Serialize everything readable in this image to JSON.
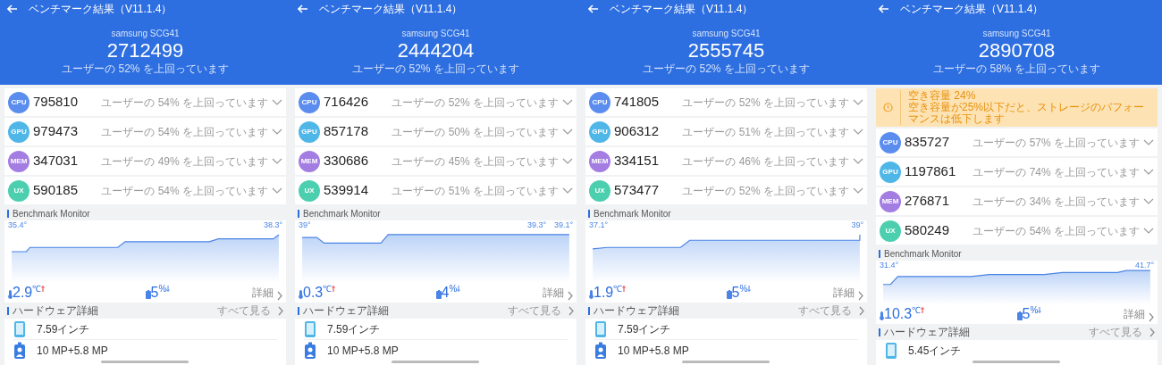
{
  "panels": [
    {
      "title": "ベンチマーク結果（V11.1.4）",
      "device": "samsung SCG41",
      "score": "2712499",
      "percentile": "ユーザーの 52% を上回っています",
      "scores": [
        {
          "badge": "CPU",
          "color": "#5b8def",
          "value": "795810",
          "percentile": "ユーザーの 54% を上回っています"
        },
        {
          "badge": "GPU",
          "color": "#4fb6e8",
          "value": "979473",
          "percentile": "ユーザーの 54% を上回っています"
        },
        {
          "badge": "MEM",
          "color": "#a47de2",
          "value": "347031",
          "percentile": "ユーザーの 49% を上回っています"
        },
        {
          "badge": "UX",
          "color": "#4ccfae",
          "value": "590185",
          "percentile": "ユーザーの 54% を上回っています"
        }
      ],
      "monitor": {
        "heading": "Benchmark Monitor",
        "point_labels": [
          {
            "kind": "start",
            "text": "35.4°"
          },
          {
            "kind": "end",
            "text": "38.3°"
          }
        ],
        "temp_rise": "2.9",
        "temp_unit": "℃",
        "battery_drop": "5",
        "battery_unit": "%",
        "details": "詳細"
      },
      "hardware": {
        "heading": "ハードウェア詳細",
        "see_all": "すべて見る",
        "items": [
          {
            "kind": "screen",
            "text": "7.59インチ"
          },
          {
            "kind": "camera",
            "text": "10 MP+5.8 MP"
          }
        ]
      }
    },
    {
      "title": "ベンチマーク結果（V11.1.4）",
      "device": "samsung SCG41",
      "score": "2444204",
      "percentile": "ユーザーの 52% を上回っています",
      "scores": [
        {
          "badge": "CPU",
          "color": "#5b8def",
          "value": "716426",
          "percentile": "ユーザーの 52% を上回っています"
        },
        {
          "badge": "GPU",
          "color": "#4fb6e8",
          "value": "857178",
          "percentile": "ユーザーの 50% を上回っています"
        },
        {
          "badge": "MEM",
          "color": "#a47de2",
          "value": "330686",
          "percentile": "ユーザーの 45% を上回っています"
        },
        {
          "badge": "UX",
          "color": "#4ccfae",
          "value": "539914",
          "percentile": "ユーザーの 51% を上回っています"
        }
      ],
      "monitor": {
        "heading": "Benchmark Monitor",
        "point_labels": [
          {
            "kind": "start",
            "text": "39°"
          },
          {
            "kind": "peak",
            "text": "39.3°"
          },
          {
            "kind": "end",
            "text": "39.1°"
          }
        ],
        "temp_rise": "0.3",
        "temp_unit": "℃",
        "battery_drop": "4",
        "battery_unit": "%",
        "details": "詳細"
      },
      "hardware": {
        "heading": "ハードウェア詳細",
        "see_all": "すべて見る",
        "items": [
          {
            "kind": "screen",
            "text": "7.59インチ"
          },
          {
            "kind": "camera",
            "text": "10 MP+5.8 MP"
          }
        ]
      }
    },
    {
      "title": "ベンチマーク結果（V11.1.4）",
      "device": "samsung SCG41",
      "score": "2555745",
      "percentile": "ユーザーの 52% を上回っています",
      "scores": [
        {
          "badge": "CPU",
          "color": "#5b8def",
          "value": "741805",
          "percentile": "ユーザーの 52% を上回っています"
        },
        {
          "badge": "GPU",
          "color": "#4fb6e8",
          "value": "906312",
          "percentile": "ユーザーの 51% を上回っています"
        },
        {
          "badge": "MEM",
          "color": "#a47de2",
          "value": "334151",
          "percentile": "ユーザーの 46% を上回っています"
        },
        {
          "badge": "UX",
          "color": "#4ccfae",
          "value": "573477",
          "percentile": "ユーザーの 52% を上回っています"
        }
      ],
      "monitor": {
        "heading": "Benchmark Monitor",
        "point_labels": [
          {
            "kind": "start",
            "text": "37.1°"
          },
          {
            "kind": "end",
            "text": "39°"
          }
        ],
        "temp_rise": "1.9",
        "temp_unit": "℃",
        "battery_drop": "5",
        "battery_unit": "%",
        "details": "詳細"
      },
      "hardware": {
        "heading": "ハードウェア詳細",
        "see_all": "すべて見る",
        "items": [
          {
            "kind": "screen",
            "text": "7.59インチ"
          },
          {
            "kind": "camera",
            "text": "10 MP+5.8 MP"
          }
        ]
      }
    },
    {
      "title": "ベンチマーク結果（V11.1.4）",
      "device": "samsung SCG41",
      "score": "2890708",
      "percentile": "ユーザーの 58% を上回っています",
      "warning": {
        "title": "空き容量 24%",
        "message": "空き容量が25%以下だと、ストレージのパフォーマンスは低下します"
      },
      "scores": [
        {
          "badge": "CPU",
          "color": "#5b8def",
          "value": "835727",
          "percentile": "ユーザーの 57% を上回っています"
        },
        {
          "badge": "GPU",
          "color": "#4fb6e8",
          "value": "1197861",
          "percentile": "ユーザーの 74% を上回っています"
        },
        {
          "badge": "MEM",
          "color": "#a47de2",
          "value": "276871",
          "percentile": "ユーザーの 34% を上回っています"
        },
        {
          "badge": "UX",
          "color": "#4ccfae",
          "value": "580249",
          "percentile": "ユーザーの 54% を上回っています"
        }
      ],
      "monitor": {
        "heading": "Benchmark Monitor",
        "point_labels": [
          {
            "kind": "start",
            "text": "31.4°"
          },
          {
            "kind": "end",
            "text": "41.7°"
          }
        ],
        "temp_rise": "10.3",
        "temp_unit": "℃",
        "battery_drop": "5",
        "battery_unit": "%",
        "details": "詳細"
      },
      "hardware": {
        "heading": "ハードウェア詳細",
        "see_all": "すべて見る",
        "items": [
          {
            "kind": "screen",
            "text": "5.45インチ"
          }
        ]
      }
    }
  ]
}
